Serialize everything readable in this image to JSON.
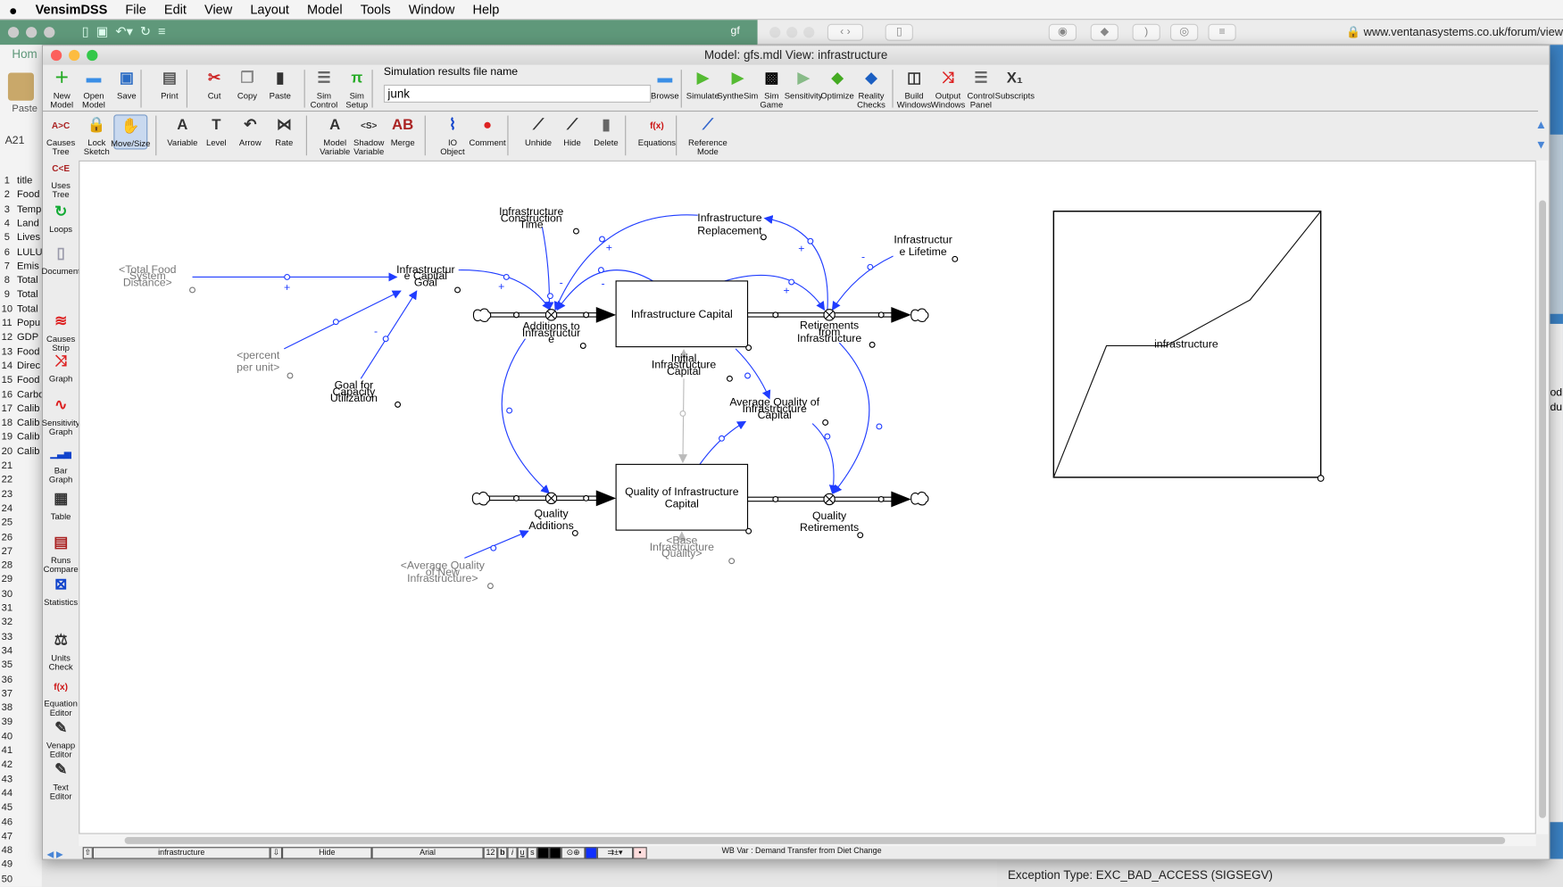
{
  "menubar": {
    "app": "VensimDSS",
    "items": [
      "File",
      "Edit",
      "View",
      "Layout",
      "Model",
      "Tools",
      "Window",
      "Help"
    ]
  },
  "excel": {
    "tab": "Hom",
    "paste": "Paste",
    "namebox": "A21",
    "rows": [
      "1",
      "2",
      "3",
      "4",
      "5",
      "6",
      "7",
      "8",
      "9",
      "10",
      "11",
      "12",
      "13",
      "14",
      "15",
      "16",
      "17",
      "18",
      "19",
      "20",
      "21",
      "22",
      "23",
      "24",
      "25",
      "26",
      "27",
      "28",
      "29",
      "30",
      "31",
      "32",
      "33",
      "34",
      "35",
      "36",
      "37",
      "38",
      "39",
      "40",
      "41",
      "42",
      "43",
      "44",
      "45",
      "46",
      "47",
      "48",
      "49",
      "50"
    ],
    "colA": [
      "title",
      "Food",
      "Temp",
      "Land",
      "Lives",
      "LULU",
      "Emis",
      "Total",
      "Total",
      "Total",
      "Popu",
      "GDP",
      "Food",
      "Direc",
      "Food",
      "Carbo",
      "Calib",
      "Calib",
      "Calib",
      "Calib"
    ],
    "doc_tab": "gf"
  },
  "browser": {
    "url": "www.ventanasystems.co.uk/forum/view",
    "side_text": [
      "odi",
      "du"
    ],
    "exception": "Exception Type: EXC_BAD_ACCESS (SIGSEGV)"
  },
  "window": {
    "title": "Model: gfs.mdl View: infrastructure"
  },
  "toolbar1": [
    {
      "id": "new-model",
      "label": "New Model",
      "icon": "new-file-icon"
    },
    {
      "id": "open-model",
      "label": "Open Model",
      "icon": "folder-icon"
    },
    {
      "id": "save",
      "label": "Save",
      "icon": "floppy-icon"
    },
    {
      "id": "print",
      "label": "Print",
      "icon": "printer-icon"
    },
    {
      "id": "cut",
      "label": "Cut",
      "icon": "scissors-icon"
    },
    {
      "id": "copy",
      "label": "Copy",
      "icon": "copy-icon"
    },
    {
      "id": "paste",
      "label": "Paste",
      "icon": "clipboard-icon"
    },
    {
      "id": "sim-control",
      "label": "Sim Control",
      "icon": "control-panel-icon"
    },
    {
      "id": "sim-setup",
      "label": "Sim Setup",
      "icon": "sim-setup-icon"
    }
  ],
  "simfile": {
    "label": "Simulation results file name",
    "value": "junk",
    "browse": "Browse"
  },
  "toolbar1b": [
    {
      "id": "simulate",
      "label": "Simulate",
      "icon": "play-icon"
    },
    {
      "id": "synthesim",
      "label": "SyntheSim",
      "icon": "synthesim-icon"
    },
    {
      "id": "game",
      "label": "Sim Game",
      "icon": "checker-icon"
    },
    {
      "id": "sensitivity",
      "label": "Sensitivity",
      "icon": "sensitivity-icon"
    },
    {
      "id": "optimize",
      "label": "Optimize",
      "icon": "optimize-icon"
    },
    {
      "id": "reality-checks",
      "label": "Reality Checks",
      "icon": "check-diamond-icon"
    },
    {
      "id": "build-windows",
      "label": "Build Windows",
      "icon": "build-windows-icon"
    },
    {
      "id": "output-windows",
      "label": "Output Windows",
      "icon": "output-graph-icon"
    },
    {
      "id": "control-panel",
      "label": "Control Panel",
      "icon": "control-panel-icon"
    },
    {
      "id": "subscripts",
      "label": "Subscripts",
      "icon": "subscript-icon"
    }
  ],
  "toolbar2": [
    {
      "id": "causes-tree",
      "label": "Causes Tree",
      "icon": "causes-tree-icon"
    },
    {
      "id": "lock-sketch",
      "label": "Lock Sketch",
      "icon": "lock-icon"
    },
    {
      "id": "move-size",
      "label": "Move/Size",
      "icon": "hand-icon",
      "active": true
    },
    {
      "id": "variable",
      "label": "Variable",
      "icon": "variable-icon"
    },
    {
      "id": "level",
      "label": "Level",
      "icon": "level-icon"
    },
    {
      "id": "arrow",
      "label": "Arrow",
      "icon": "arrow-icon"
    },
    {
      "id": "rate",
      "label": "Rate",
      "icon": "rate-icon"
    },
    {
      "id": "model-variable",
      "label": "Model Variable",
      "icon": "variable-icon"
    },
    {
      "id": "shadow-variable",
      "label": "Shadow Variable",
      "icon": "shadow-variable-icon"
    },
    {
      "id": "merge",
      "label": "Merge",
      "icon": "merge-icon"
    },
    {
      "id": "io-object",
      "label": "IO Object",
      "icon": "io-object-icon"
    },
    {
      "id": "comment",
      "label": "Comment",
      "icon": "comment-icon"
    },
    {
      "id": "unhide",
      "label": "Unhide",
      "icon": "wand-icon"
    },
    {
      "id": "hide",
      "label": "Hide",
      "icon": "wand-icon"
    },
    {
      "id": "delete",
      "label": "Delete",
      "icon": "trash-icon"
    },
    {
      "id": "equations",
      "label": "Equations",
      "icon": "function-icon"
    },
    {
      "id": "reference-mode",
      "label": "Reference Mode",
      "icon": "reference-mode-icon"
    }
  ],
  "palette": [
    {
      "id": "uses-tree",
      "label": "Uses Tree",
      "icon": "uses-tree-icon"
    },
    {
      "id": "loops",
      "label": "Loops",
      "icon": "loops-icon"
    },
    {
      "id": "document",
      "label": "Document",
      "icon": "document-icon"
    },
    {
      "id": "causes-strip",
      "label": "Causes Strip",
      "icon": "causes-strip-icon"
    },
    {
      "id": "graph",
      "label": "Graph",
      "icon": "graph-icon"
    },
    {
      "id": "sensitivity-graph",
      "label": "Sensitivity Graph",
      "icon": "sensitivity-graph-icon"
    },
    {
      "id": "bar-graph",
      "label": "Bar Graph",
      "icon": "bar-graph-icon"
    },
    {
      "id": "table",
      "label": "Table",
      "icon": "table-icon"
    },
    {
      "id": "runs-compare",
      "label": "Runs Compare",
      "icon": "runs-compare-icon"
    },
    {
      "id": "statistics",
      "label": "Statistics",
      "icon": "statistics-icon"
    },
    {
      "id": "units-check",
      "label": "Units Check",
      "icon": "scale-icon"
    },
    {
      "id": "equation-editor",
      "label": "Equation Editor",
      "icon": "function-icon"
    },
    {
      "id": "venapp-editor",
      "label": "Venapp Editor",
      "icon": "venapp-icon"
    },
    {
      "id": "text-editor",
      "label": "Text Editor",
      "icon": "text-editor-icon"
    }
  ],
  "status": {
    "view": "infrastructure",
    "hide": "Hide",
    "font": "Arial",
    "size": "12",
    "bold": "b",
    "italic": "i",
    "underline": "u",
    "strike": "s",
    "message": "WB Var : Demand Transfer from Diet Change"
  },
  "diagram": {
    "link_color": "#1f3cff",
    "stocks": {
      "infra_capital": [
        "Infrastructure Capital"
      ],
      "quality_capital": [
        "Quality of Infrastructure",
        "Capital"
      ]
    },
    "flows": {
      "additions": [
        "Additions to",
        "Infrastructur",
        "e"
      ],
      "retirements": [
        "Retirements",
        "from",
        "Infrastructure"
      ],
      "quality_additions": [
        "Quality",
        "Additions"
      ],
      "quality_retirements": [
        "Quality",
        "Retirements"
      ]
    },
    "auxiliaries": {
      "construction_time": [
        "Infrastructure",
        "Construction",
        "Time"
      ],
      "replacement": [
        "Infrastructure",
        "Replacement"
      ],
      "lifetime": [
        "Infrastructur",
        "e Lifetime"
      ],
      "capital_goal": [
        "Infrastructur",
        "e Capital",
        "Goal"
      ],
      "capacity_goal": [
        "Goal for",
        "Capacity",
        "Utilization"
      ],
      "initial_capital": [
        "Initial",
        "Infrastructure",
        "Capital"
      ],
      "avg_quality": [
        "Average Quality of",
        "Infrastructure",
        "Capital"
      ]
    },
    "shadows": {
      "food_distance": [
        "<Total Food",
        "System",
        "Distance>"
      ],
      "percent_per_unit": [
        "<percent",
        "per unit>"
      ],
      "base_quality": [
        "<Base",
        "Infrastructure",
        "Quality>"
      ],
      "avg_new_quality": [
        "<Average Quality",
        "of New",
        "Infrastructure>"
      ]
    },
    "polarities": [
      "+",
      "-",
      "+",
      "-",
      "+",
      "-",
      "+",
      "+",
      "-"
    ],
    "lookup_label": "infrastructure"
  }
}
